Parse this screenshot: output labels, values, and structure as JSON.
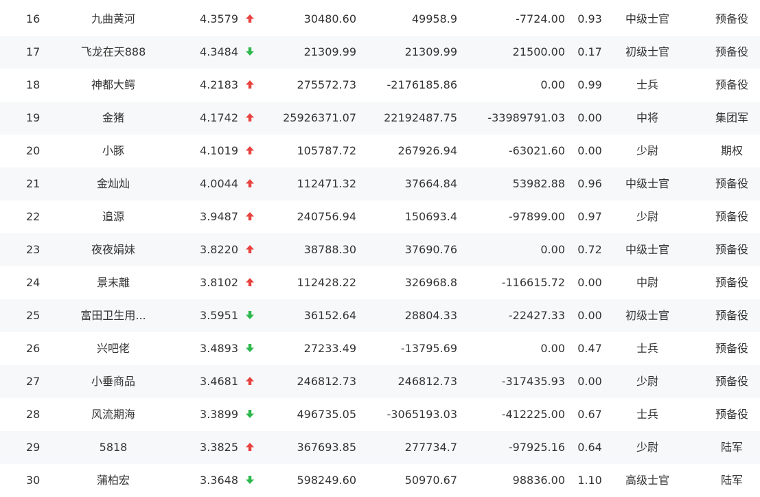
{
  "colors": {
    "up_arrow": "#e8423f",
    "down_arrow": "#2db84d",
    "text": "#333333",
    "row_alt_background": "#f7f8fa"
  },
  "rows": [
    {
      "rank": "16",
      "name": "九曲黄河",
      "score": "4.3579",
      "trend": "up",
      "trend_icon": "arrow-up-icon",
      "value1": "30480.60",
      "value2": "49958.9",
      "value3": "-7724.00",
      "ratio": "0.93",
      "level": "中级士官",
      "type": "预备役"
    },
    {
      "rank": "17",
      "name": "飞龙在天888",
      "score": "4.3484",
      "trend": "down",
      "trend_icon": "arrow-down-icon",
      "value1": "21309.99",
      "value2": "21309.99",
      "value3": "21500.00",
      "ratio": "0.17",
      "level": "初级士官",
      "type": "预备役"
    },
    {
      "rank": "18",
      "name": "神都大鳄",
      "score": "4.2183",
      "trend": "up",
      "trend_icon": "arrow-up-icon",
      "value1": "275572.73",
      "value2": "-2176185.86",
      "value3": "0.00",
      "ratio": "0.99",
      "level": "士兵",
      "type": "预备役"
    },
    {
      "rank": "19",
      "name": "金猪",
      "score": "4.1742",
      "trend": "up",
      "trend_icon": "arrow-up-icon",
      "value1": "25926371.07",
      "value2": "22192487.75",
      "value3": "-33989791.03",
      "ratio": "0.00",
      "level": "中将",
      "type": "集团军"
    },
    {
      "rank": "20",
      "name": "小豚",
      "score": "4.1019",
      "trend": "up",
      "trend_icon": "arrow-up-icon",
      "value1": "105787.72",
      "value2": "267926.94",
      "value3": "-63021.60",
      "ratio": "0.00",
      "level": "少尉",
      "type": "期权"
    },
    {
      "rank": "21",
      "name": "金灿灿",
      "score": "4.0044",
      "trend": "up",
      "trend_icon": "arrow-up-icon",
      "value1": "112471.32",
      "value2": "37664.84",
      "value3": "53982.88",
      "ratio": "0.96",
      "level": "中级士官",
      "type": "预备役"
    },
    {
      "rank": "22",
      "name": "追源",
      "score": "3.9487",
      "trend": "up",
      "trend_icon": "arrow-up-icon",
      "value1": "240756.94",
      "value2": "150693.4",
      "value3": "-97899.00",
      "ratio": "0.97",
      "level": "少尉",
      "type": "预备役"
    },
    {
      "rank": "23",
      "name": "夜夜娟妹",
      "score": "3.8220",
      "trend": "up",
      "trend_icon": "arrow-up-icon",
      "value1": "38788.30",
      "value2": "37690.76",
      "value3": "0.00",
      "ratio": "0.72",
      "level": "中级士官",
      "type": "预备役"
    },
    {
      "rank": "24",
      "name": "景末離",
      "score": "3.8102",
      "trend": "up",
      "trend_icon": "arrow-up-icon",
      "value1": "112428.22",
      "value2": "326968.8",
      "value3": "-116615.72",
      "ratio": "0.00",
      "level": "中尉",
      "type": "预备役"
    },
    {
      "rank": "25",
      "name": "富田卫生用...",
      "score": "3.5951",
      "trend": "down",
      "trend_icon": "arrow-down-icon",
      "value1": "36152.64",
      "value2": "28804.33",
      "value3": "-22427.33",
      "ratio": "0.00",
      "level": "初级士官",
      "type": "预备役"
    },
    {
      "rank": "26",
      "name": "兴吧佬",
      "score": "3.4893",
      "trend": "down",
      "trend_icon": "arrow-down-icon",
      "value1": "27233.49",
      "value2": "-13795.69",
      "value3": "0.00",
      "ratio": "0.47",
      "level": "士兵",
      "type": "预备役"
    },
    {
      "rank": "27",
      "name": "小垂商品",
      "score": "3.4681",
      "trend": "up",
      "trend_icon": "arrow-up-icon",
      "value1": "246812.73",
      "value2": "246812.73",
      "value3": "-317435.93",
      "ratio": "0.00",
      "level": "少尉",
      "type": "预备役"
    },
    {
      "rank": "28",
      "name": "风流期海",
      "score": "3.3899",
      "trend": "down",
      "trend_icon": "arrow-down-icon",
      "value1": "496735.05",
      "value2": "-3065193.03",
      "value3": "-412225.00",
      "ratio": "0.67",
      "level": "士兵",
      "type": "预备役"
    },
    {
      "rank": "29",
      "name": "5818",
      "score": "3.3825",
      "trend": "up",
      "trend_icon": "arrow-up-icon",
      "value1": "367693.85",
      "value2": "277734.7",
      "value3": "-97925.16",
      "ratio": "0.64",
      "level": "少尉",
      "type": "陆军"
    },
    {
      "rank": "30",
      "name": "蒲柏宏",
      "score": "3.3648",
      "trend": "down",
      "trend_icon": "arrow-down-icon",
      "value1": "598249.60",
      "value2": "50970.67",
      "value3": "98836.00",
      "ratio": "1.10",
      "level": "高级士官",
      "type": "陆军"
    }
  ]
}
